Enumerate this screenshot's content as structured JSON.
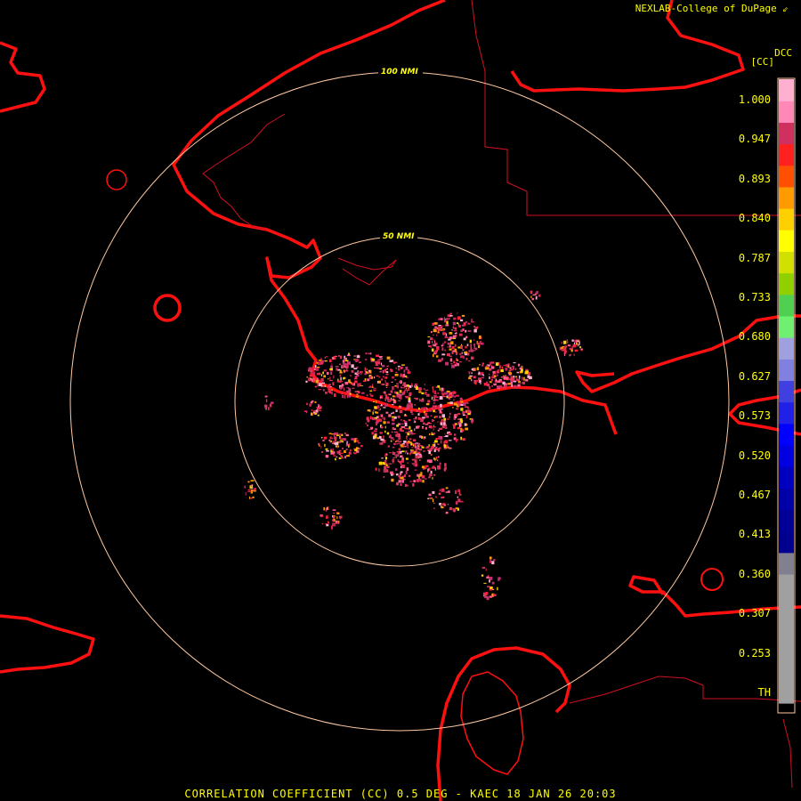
{
  "header": {
    "credit": "NEXLAB-College of DuPage"
  },
  "footer": {
    "caption": "CORRELATION COEFFICIENT (CC) 0.5 DEG - KAEC 18 JAN 26 20:03"
  },
  "rings": [
    {
      "label": "50 NMI",
      "range_nmi": 50
    },
    {
      "label": "100 NMI",
      "range_nmi": 100
    }
  ],
  "colorbar": {
    "product": "DCC",
    "unit": "[CC]",
    "ticks": [
      "1.000",
      "0.947",
      "0.893",
      "0.840",
      "0.787",
      "0.733",
      "0.680",
      "0.627",
      "0.573",
      "0.520",
      "0.467",
      "0.413",
      "0.360",
      "0.307",
      "0.253",
      "TH"
    ],
    "colors": [
      "#ffb0d0",
      "#ff88b8",
      "#d03060",
      "#ff2020",
      "#ff5000",
      "#ff9a00",
      "#ffd000",
      "#ffff00",
      "#d0e000",
      "#90d000",
      "#50d050",
      "#70f070",
      "#a0a0e0",
      "#8080e0",
      "#4040e0",
      "#2020e8",
      "#0000ff",
      "#0000e0",
      "#0000c0",
      "#0000a8",
      "#000098",
      "#000090",
      "#808090",
      "#a0a0a0",
      "#a0a0a0",
      "#a0a0a0",
      "#a0a0a0",
      "#a0a0a0",
      "#a0a0a0"
    ]
  },
  "styles": {
    "coast": "#ff1010",
    "border": "#d01020",
    "ring": "#ffc8a0",
    "label": "#ffff00",
    "echo": "#e03058"
  },
  "icons": {
    "credit": "corner-arrow-icon"
  }
}
